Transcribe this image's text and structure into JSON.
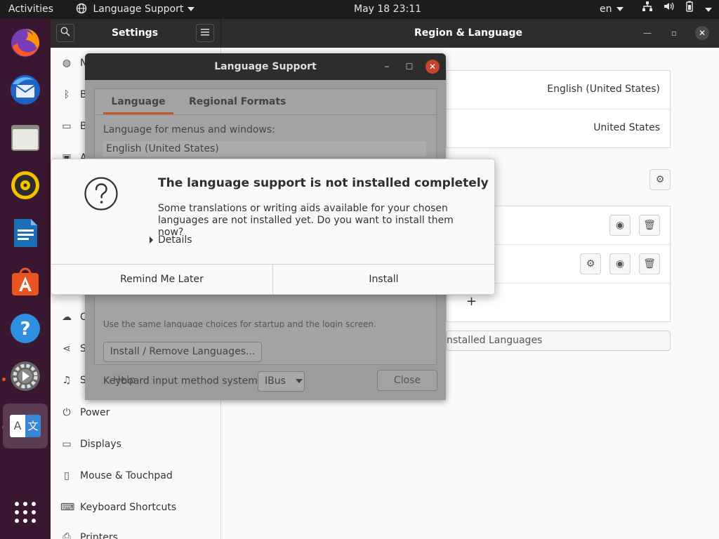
{
  "topbar": {
    "activities": "Activities",
    "app_menu": "Language Support",
    "clock": "May 18  23:11",
    "input_lang": "en"
  },
  "dock": {
    "items": [
      "firefox-icon",
      "thunderbird-icon",
      "files-icon",
      "rhythmbox-icon",
      "libreoffice-writer-icon",
      "software-icon",
      "help-icon",
      "settings-icon",
      "language-support-icon"
    ],
    "show_apps": "show-applications-icon",
    "active_glyphs": [
      "A",
      "文"
    ]
  },
  "settings": {
    "title": "Settings",
    "page_title": "Region & Language",
    "sidebar": [
      {
        "label": "N",
        "icon": "network-icon"
      },
      {
        "label": "B",
        "icon": "bluetooth-icon"
      },
      {
        "label": "B",
        "icon": "background-icon"
      },
      {
        "label": "A",
        "icon": "appearance-icon"
      },
      {
        "label": "C",
        "icon": "cloud-icon"
      },
      {
        "label": "S",
        "icon": "share-icon"
      },
      {
        "label": "S",
        "icon": "music-icon"
      },
      {
        "label": "Power",
        "icon": "power-icon"
      },
      {
        "label": "Displays",
        "icon": "display-icon"
      },
      {
        "label": "Mouse & Touchpad",
        "icon": "mouse-icon"
      },
      {
        "label": "Keyboard Shortcuts",
        "icon": "keyboard-icon"
      },
      {
        "label": "Printers",
        "icon": "printer-icon"
      }
    ],
    "language_value": "English (United States)",
    "formats_value": "United States",
    "add_symbol": "+",
    "manage_button": "nstalled Languages"
  },
  "lang_support": {
    "title": "Language Support",
    "tabs": [
      "Language",
      "Regional Formats"
    ],
    "menus_label": "Language for menus and windows:",
    "first_language": "English (United States)",
    "cut_text": "Use the same language choices for startup and the login screen.",
    "install_remove": "Install / Remove Languages...",
    "keyboard_label": "Keyboard input method system:",
    "keyboard_value": "IBus",
    "help": "Help",
    "close": "Close"
  },
  "dialog": {
    "title": "The language support is not installed completely",
    "message": "Some translations or writing aids available for your chosen languages are not installed yet. Do you want to install them now?",
    "details": "Details",
    "remind_later": "Remind Me Later",
    "install": "Install"
  }
}
